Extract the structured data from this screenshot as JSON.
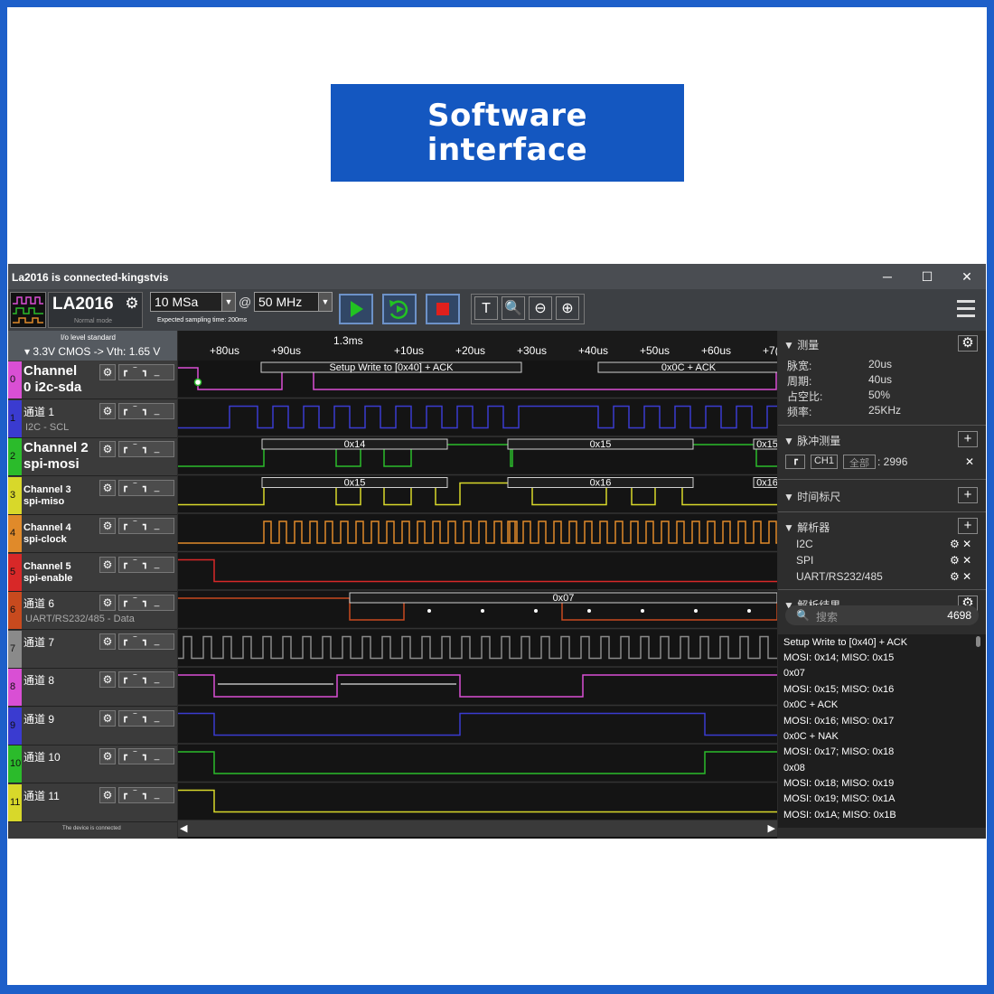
{
  "banner": {
    "line1": "Software",
    "line2": "interface"
  },
  "window": {
    "title": "La2016 is connected-kingstvis",
    "minimize": "─",
    "maximize": "☐",
    "close": "✕"
  },
  "toolbar": {
    "device": "LA2016",
    "mode": "Normal mode",
    "sample_count": "10 MSa",
    "at": "@",
    "sample_rate": "50 MHz",
    "expected": "Expected sampling time: 200ms",
    "play_icon": "play-icon",
    "colors": {
      "accent": "#6d92c8",
      "play": "#22c322",
      "stop": "#e0201c"
    }
  },
  "io": {
    "standard_label": "I/o level standard",
    "level": "▾ 3.3V CMOS  -> Vth: 1.65 V"
  },
  "ruler": {
    "center": "1.3ms",
    "ticks": [
      "+80us",
      "+90us",
      "+10us",
      "+20us",
      "+30us",
      "+40us",
      "+50us",
      "+60us",
      "+7("
    ]
  },
  "channels": [
    {
      "num": "0",
      "color": "#d94fd4",
      "style": "big",
      "line1": "Channel",
      "line2": "0 i2c-sda"
    },
    {
      "num": "1",
      "color": "#3a3bd0",
      "style": "small",
      "line1": "通道 1",
      "line2": "I2C - SCL"
    },
    {
      "num": "2",
      "color": "#2bbb2b",
      "style": "big",
      "line1": "Channel 2",
      "line2": "spi-mosi"
    },
    {
      "num": "3",
      "color": "#d8d82a",
      "style": "med",
      "line1": "Channel 3",
      "line2": "spi-miso"
    },
    {
      "num": "4",
      "color": "#e08a2a",
      "style": "med",
      "line1": "Channel 4",
      "line2": "spi-clock"
    },
    {
      "num": "5",
      "color": "#d82828",
      "style": "med",
      "line1": "Channel 5",
      "line2": "spi-enable"
    },
    {
      "num": "6",
      "color": "#c84a1e",
      "style": "small",
      "line1": "通道 6",
      "line2": "UART/RS232/485 - Data"
    },
    {
      "num": "7",
      "color": "#8a8a8a",
      "style": "small",
      "line1": "通道 7",
      "line2": ""
    },
    {
      "num": "8",
      "color": "#d94fd4",
      "style": "small",
      "line1": "通道 8",
      "line2": ""
    },
    {
      "num": "9",
      "color": "#3a3bd0",
      "style": "small",
      "line1": "通道 9",
      "line2": ""
    },
    {
      "num": "10",
      "color": "#2bbb2b",
      "style": "small",
      "line1": "通道 10",
      "line2": ""
    },
    {
      "num": "11",
      "color": "#d8d82a",
      "style": "small",
      "line1": "通道 11",
      "line2": ""
    }
  ],
  "trigger_glyphs": "┏ ‾ ┓ _",
  "decode_labels": {
    "ch0": [
      "Setup Write to [0x40] + ACK",
      "0x0C + ACK"
    ],
    "ch2": [
      "0x14",
      "0x15"
    ],
    "ch3": [
      "0x15",
      "0x16"
    ],
    "ch6": [
      "0x07"
    ]
  },
  "status": "The device is connected",
  "panel": {
    "measure": {
      "title": "▼ 测量",
      "rows": [
        [
          "脉宽:",
          "20us"
        ],
        [
          "周期:",
          "40us"
        ],
        [
          "占空比:",
          "50%"
        ],
        [
          "频率:",
          "25KHz"
        ]
      ]
    },
    "pulse": {
      "title": "▼ 脉冲测量",
      "ch": "CH1",
      "all": "全部",
      "count": ": 2996"
    },
    "cursor": {
      "title": "▼ 时间标尺"
    },
    "analyzers": {
      "title": "▼ 解析器",
      "items": [
        "I2C",
        "SPI",
        "UART/RS232/485"
      ]
    },
    "results": {
      "title": "▼ 解析结果",
      "search_placeholder": "搜索",
      "count": "4698",
      "items": [
        "Setup Write to [0x40] + ACK",
        "MOSI: 0x14;  MISO: 0x15",
        "0x07",
        "MOSI: 0x15;  MISO: 0x16",
        "0x0C + ACK",
        "MOSI: 0x16;  MISO: 0x17",
        "0x0C + NAK",
        "MOSI: 0x17;  MISO: 0x18",
        "0x08",
        "MOSI: 0x18;  MISO: 0x19",
        "MOSI: 0x19;  MISO: 0x1A",
        "MOSI: 0x1A;  MISO: 0x1B"
      ]
    }
  }
}
